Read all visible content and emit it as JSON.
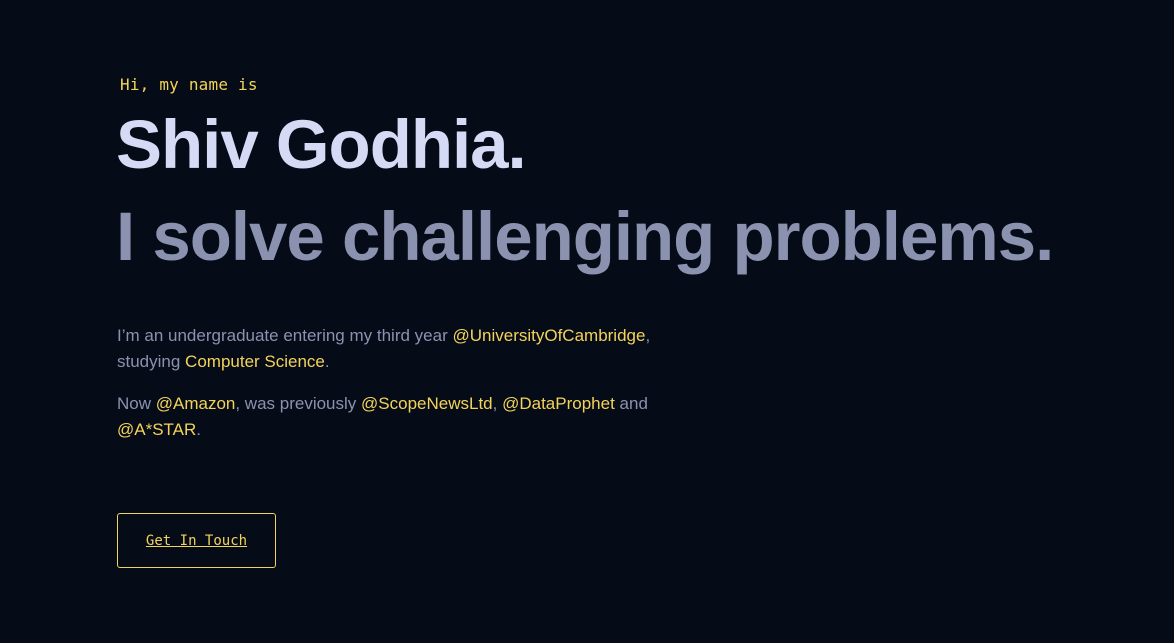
{
  "hero": {
    "greeting": "Hi, my name is",
    "name": "Shiv Godhia.",
    "tagline": "I solve challenging problems."
  },
  "bio": {
    "line1": {
      "text_a": "I’m an undergraduate entering my third year ",
      "link_university": "@UniversityOfCambridge",
      "text_b": ", studying ",
      "link_subject": "Computer Science",
      "text_c": "."
    },
    "line2": {
      "text_a": "Now ",
      "link_amazon": "@Amazon",
      "text_b": ", was previously ",
      "link_scope": "@ScopeNewsLtd",
      "text_c": ", ",
      "link_dataprophet": "@DataProphet",
      "text_d": " and ",
      "link_astar": "@A*STAR",
      "text_e": "."
    }
  },
  "cta": {
    "label": "Get In Touch"
  },
  "colors": {
    "background": "#050b17",
    "accent": "#f3d35b",
    "heading": "#d6dbf5",
    "muted": "#8b92b0"
  }
}
